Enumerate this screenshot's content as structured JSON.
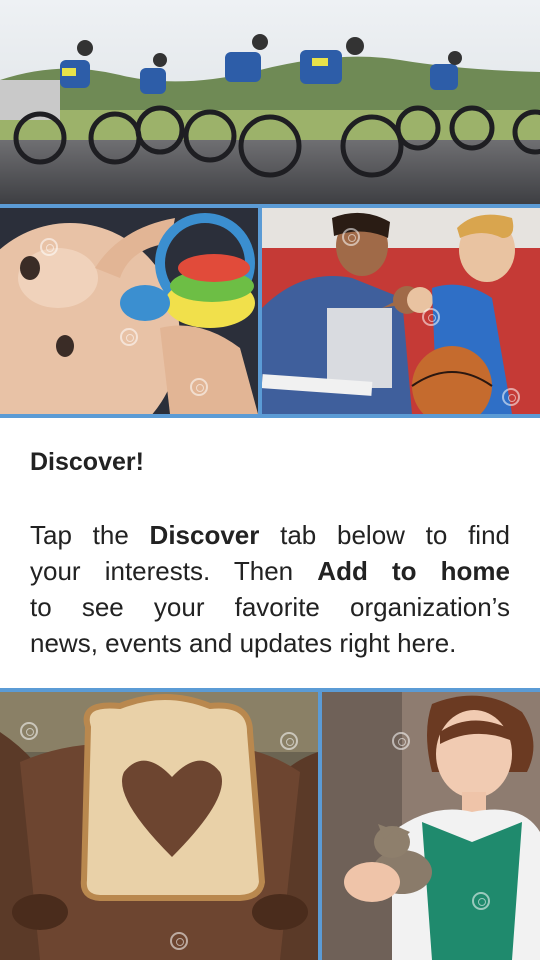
{
  "banner_images": {
    "top": "cyclists-road-race-photo",
    "middle_left": "baby-with-toy-rings-photo",
    "middle_right": "coach-fist-bump-basketball-photo",
    "bottom_left": "hands-holding-bread-heart-photo",
    "bottom_right": "woman-holding-kitten-photo"
  },
  "discover": {
    "heading": "Discover!",
    "line1_a": "Tap the ",
    "line1_b": "Discover",
    "line1_c": " tab below to find",
    "line2_a": "your interests. Then ",
    "line2_b": "Add to home",
    "line3": "to see your favorite organization’s",
    "line4": "news, events and updates right here."
  },
  "colors": {
    "divider": "#5b9bd5",
    "text": "#222222",
    "background": "#ffffff"
  }
}
